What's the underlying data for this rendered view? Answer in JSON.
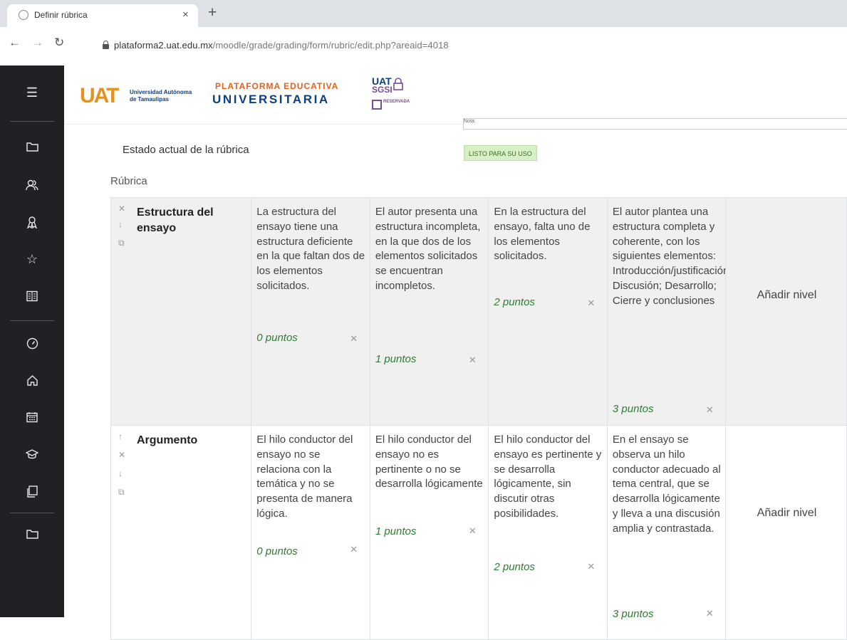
{
  "browser": {
    "tab_title": "Definir rúbrica",
    "tab_close": "×",
    "new_tab": "+",
    "url_host": "plataforma2.uat.edu.mx",
    "url_path": "/moodle/grade/grading/form/rubric/edit.php?areaid=4018"
  },
  "header": {
    "uat_logo": "UAT",
    "uat_sub_1": "Universidad Autónoma",
    "uat_sub_2": "de Tamaulipas",
    "plat_1": "PLATAFORMA EDUCATIVA",
    "plat_2": "UNIVERSITARIA",
    "sgsi_1": "UAT",
    "sgsi_2": "SGSI",
    "sgsi_res": "RESERVADA"
  },
  "page": {
    "note_field": "Nota:",
    "estado_label": "Estado actual de la rúbrica",
    "status_badge": "LISTO PARA SU USO",
    "rubrica_label": "Rúbrica"
  },
  "rubric": {
    "add_level_label": "Añadir nivel",
    "criteria": [
      {
        "name": "Estructura del ensayo",
        "levels": [
          {
            "definition": "La estructura del ensayo tiene una estructura deficiente en la que faltan dos de los elementos solicitados.",
            "score": "0 puntos"
          },
          {
            "definition": "El autor presenta una estructura incompleta, en la que dos de los elementos solicitados se encuentran incompletos.",
            "score": "1 puntos"
          },
          {
            "definition": "En la estructura del ensayo, falta uno de los elementos solicitados.",
            "score": "2 puntos"
          },
          {
            "definition": "El autor plantea una estructura completa y coherente, con los siguientes elementos: Introducción/justificación; Discusión; Desarrollo; Cierre y conclusiones",
            "score": "3 puntos"
          }
        ]
      },
      {
        "name": "Argumento",
        "levels": [
          {
            "definition": "El hilo conductor del ensayo no se relaciona con la temática y no se presenta de manera lógica.",
            "score": "0 puntos"
          },
          {
            "definition": "El hilo conductor del ensayo no es pertinente o no se desarrolla lógicamente",
            "score": "1 puntos"
          },
          {
            "definition": "El hilo conductor del ensayo es pertinente y se desarrolla lógicamente, sin discutir otras posibilidades.",
            "score": "2 puntos"
          },
          {
            "definition": "En el ensayo se observa un hilo conductor adecuado al tema central, que se desarrolla lógicamente y lleva a una discusión amplia y contrastada.",
            "score": "3 puntos"
          }
        ]
      }
    ]
  },
  "icons": {
    "delete": "✕",
    "move_down": "↓",
    "move_up": "↑",
    "duplicate": "⧉"
  }
}
